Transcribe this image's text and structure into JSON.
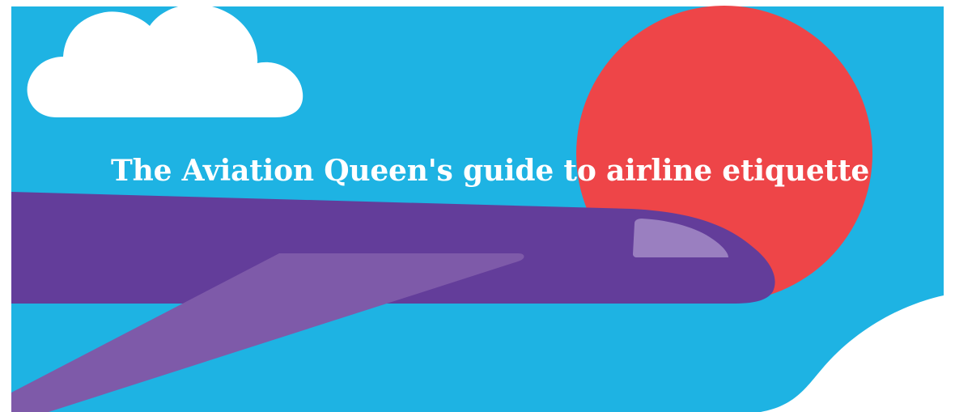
{
  "banner": {
    "title_part1": "The Aviation Queen's guide to ",
    "title_part2": "airline etiquette"
  },
  "colors": {
    "sky": "#1eb3e3",
    "sun": "#ee4548",
    "cloud": "#ffffff",
    "fuselage": "#633d9a",
    "wing": "#7e5aa9",
    "cockpit_window": "#9a7fc0",
    "title_text": "#ffffff"
  },
  "illustration": {
    "elements": [
      "cloud",
      "sun",
      "airplane",
      "wing",
      "cockpit-window",
      "white-ground"
    ]
  }
}
